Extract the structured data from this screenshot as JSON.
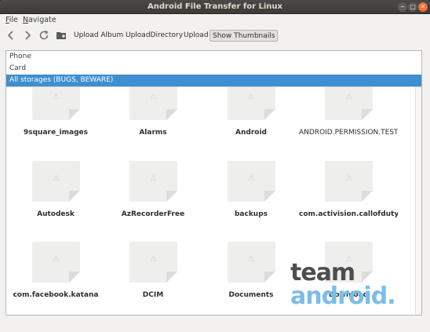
{
  "window": {
    "title": "Android File Transfer for Linux",
    "controls": {
      "minimize": "−",
      "maximize": "□",
      "close": "✕"
    }
  },
  "menu": {
    "file_u": "F",
    "file_rest": "ile",
    "navigate_u": "N",
    "navigate_rest": "avigate"
  },
  "toolbar": {
    "back_icon": "back-arrow-icon",
    "forward_icon": "forward-arrow-icon",
    "refresh_icon": "refresh-icon",
    "new_folder_icon": "new-folder-icon",
    "upload_album": "Upload Album",
    "upload_directory": "UploadDirectory",
    "upload": "Upload",
    "show_thumbnails": "Show Thumbnails"
  },
  "storages": [
    {
      "label": "Phone"
    },
    {
      "label": "Card"
    },
    {
      "label": "All storages (BUGS, BEWARE)",
      "selected": true
    }
  ],
  "folders": [
    "9square_images",
    "Alarms",
    "Android",
    "ANDROID.PERMISSION.TEST",
    "Autodesk",
    "AzRecorderFree",
    "backups",
    "com.activision.callofduty...",
    "com.facebook.katana",
    "DCIM",
    "Documents",
    "Download"
  ],
  "watermark": {
    "line1": "team",
    "line2": "android."
  },
  "colors": {
    "selection": "#3d8fd1",
    "close_button": "#f46e38"
  }
}
